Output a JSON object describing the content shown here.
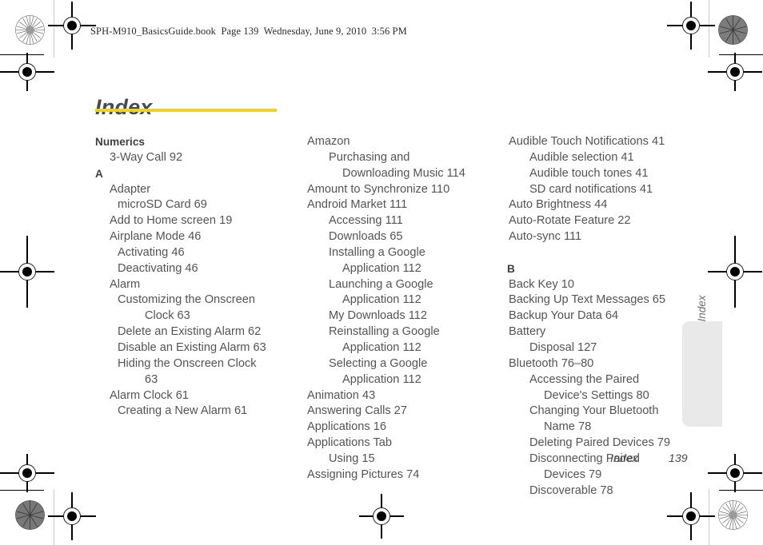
{
  "book_header": "SPH-M910_BasicsGuide.book  Page 139  Wednesday, June 9, 2010  3:56 PM",
  "page_title": "Index",
  "accent_color": "#eed21e",
  "side_tab": {
    "label": "Index"
  },
  "footer": {
    "label": "Index",
    "page_number": "139"
  },
  "columns": [
    {
      "id": "column-1",
      "blocks": [
        {
          "type": "section",
          "text": "Numerics"
        },
        {
          "type": "l1",
          "text": "3-Way Call 92"
        },
        {
          "type": "section",
          "text": "A"
        },
        {
          "type": "l1",
          "text": "Adapter"
        },
        {
          "type": "l2",
          "text": "microSD Card 69"
        },
        {
          "type": "l1",
          "text": "Add to Home screen 19"
        },
        {
          "type": "l1",
          "text": "Airplane Mode 46"
        },
        {
          "type": "l2",
          "text": "Activating 46"
        },
        {
          "type": "l2",
          "text": "Deactivating 46"
        },
        {
          "type": "l1",
          "text": "Alarm"
        },
        {
          "type": "l2",
          "text": "Customizing the Onscreen",
          "cont": "Clock 63"
        },
        {
          "type": "l2",
          "text": "Delete an Existing Alarm 62"
        },
        {
          "type": "l2",
          "text": "Disable an Existing Alarm 63"
        },
        {
          "type": "l2",
          "text": "Hiding the Onscreen Clock",
          "cont": "63"
        },
        {
          "type": "l1",
          "text": "Alarm Clock 61"
        },
        {
          "type": "l2",
          "text": "Creating a New Alarm 61"
        }
      ]
    },
    {
      "id": "column-2",
      "blocks": [
        {
          "type": "l1",
          "text": "Amazon"
        },
        {
          "type": "l2",
          "text": "Purchasing and",
          "cont": "Downloading Music 114"
        },
        {
          "type": "l1",
          "text": "Amount to Synchronize 110"
        },
        {
          "type": "l1",
          "text": "Android Market 111"
        },
        {
          "type": "l2",
          "text": "Accessing 111"
        },
        {
          "type": "l2",
          "text": "Downloads 65"
        },
        {
          "type": "l2",
          "text": "Installing a Google",
          "cont": "Application 112"
        },
        {
          "type": "l2",
          "text": "Launching a Google",
          "cont": "Application 112"
        },
        {
          "type": "l2",
          "text": "My Downloads 112"
        },
        {
          "type": "l2",
          "text": "Reinstalling a Google",
          "cont": "Application 112"
        },
        {
          "type": "l2",
          "text": "Selecting a Google",
          "cont": "Application 112"
        },
        {
          "type": "l1",
          "text": "Animation 43"
        },
        {
          "type": "l1",
          "text": "Answering Calls 27"
        },
        {
          "type": "l1",
          "text": "Applications 16"
        },
        {
          "type": "l1",
          "text": "Applications Tab"
        },
        {
          "type": "l2",
          "text": "Using 15"
        },
        {
          "type": "l1",
          "text": "Assigning Pictures 74"
        }
      ]
    },
    {
      "id": "column-3",
      "blocks": [
        {
          "type": "l1",
          "text": "Audible Touch Notifications 41"
        },
        {
          "type": "l2",
          "text": "Audible selection 41"
        },
        {
          "type": "l2",
          "text": "Audible touch tones 41"
        },
        {
          "type": "l2",
          "text": "SD card notifications 41"
        },
        {
          "type": "l1",
          "text": "Auto Brightness 44"
        },
        {
          "type": "l1",
          "text": "Auto-Rotate Feature 22"
        },
        {
          "type": "l1",
          "text": "Auto-sync 111"
        },
        {
          "type": "spacer"
        },
        {
          "type": "section",
          "text": "B"
        },
        {
          "type": "l1",
          "text": "Back Key 10"
        },
        {
          "type": "l1",
          "text": "Backing Up Text Messages 65"
        },
        {
          "type": "l1",
          "text": "Backup Your Data 64"
        },
        {
          "type": "l1",
          "text": "Battery"
        },
        {
          "type": "l2",
          "text": "Disposal 127"
        },
        {
          "type": "l1",
          "text": "Bluetooth 76–80"
        },
        {
          "type": "l2",
          "text": "Accessing the Paired",
          "cont": "Device's Settings 80"
        },
        {
          "type": "l2",
          "text": "Changing Your Bluetooth",
          "cont": "Name 78"
        },
        {
          "type": "l2",
          "text": "Deleting Paired Devices 79"
        },
        {
          "type": "l2",
          "text": "Disconnecting Paired",
          "cont": "Devices 79"
        },
        {
          "type": "l2",
          "text": "Discoverable 78"
        }
      ]
    }
  ]
}
